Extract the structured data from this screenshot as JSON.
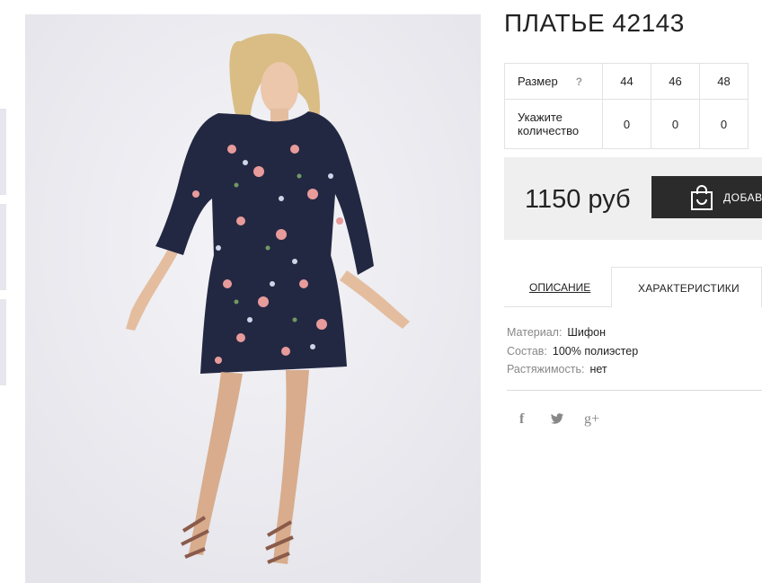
{
  "product": {
    "title": "ПЛАТЬЕ 42143",
    "image_alt": "dress-photo"
  },
  "size_table": {
    "size_label": "Размер",
    "help": "?",
    "sizes": [
      "44",
      "46",
      "48"
    ],
    "qty_label": "Укажите количество",
    "quantities": [
      "0",
      "0",
      "0"
    ]
  },
  "price_bar": {
    "price": "1150 руб",
    "cart_button": "ДОБАВИТЬ В КОРЗИНУ"
  },
  "tabs": [
    {
      "label": "ОПИСАНИЕ",
      "active": false
    },
    {
      "label": "ХАРАКТЕРИСТИКИ",
      "active": true
    }
  ],
  "characteristics": [
    {
      "key": "Материал:",
      "value": "Шифон"
    },
    {
      "key": "Состав:",
      "value": "100% полиэстер"
    },
    {
      "key": "Растяжимость:",
      "value": "нет"
    }
  ],
  "social": {
    "icons": [
      "facebook-icon",
      "twitter-icon",
      "google-plus-icon"
    ],
    "facebook": "f",
    "google_plus": "g+"
  },
  "colors": {
    "dark_button": "#2b2b2b",
    "price_bar_bg": "#efefef",
    "dress": "#232842",
    "photo_bg": "#ececf1"
  }
}
